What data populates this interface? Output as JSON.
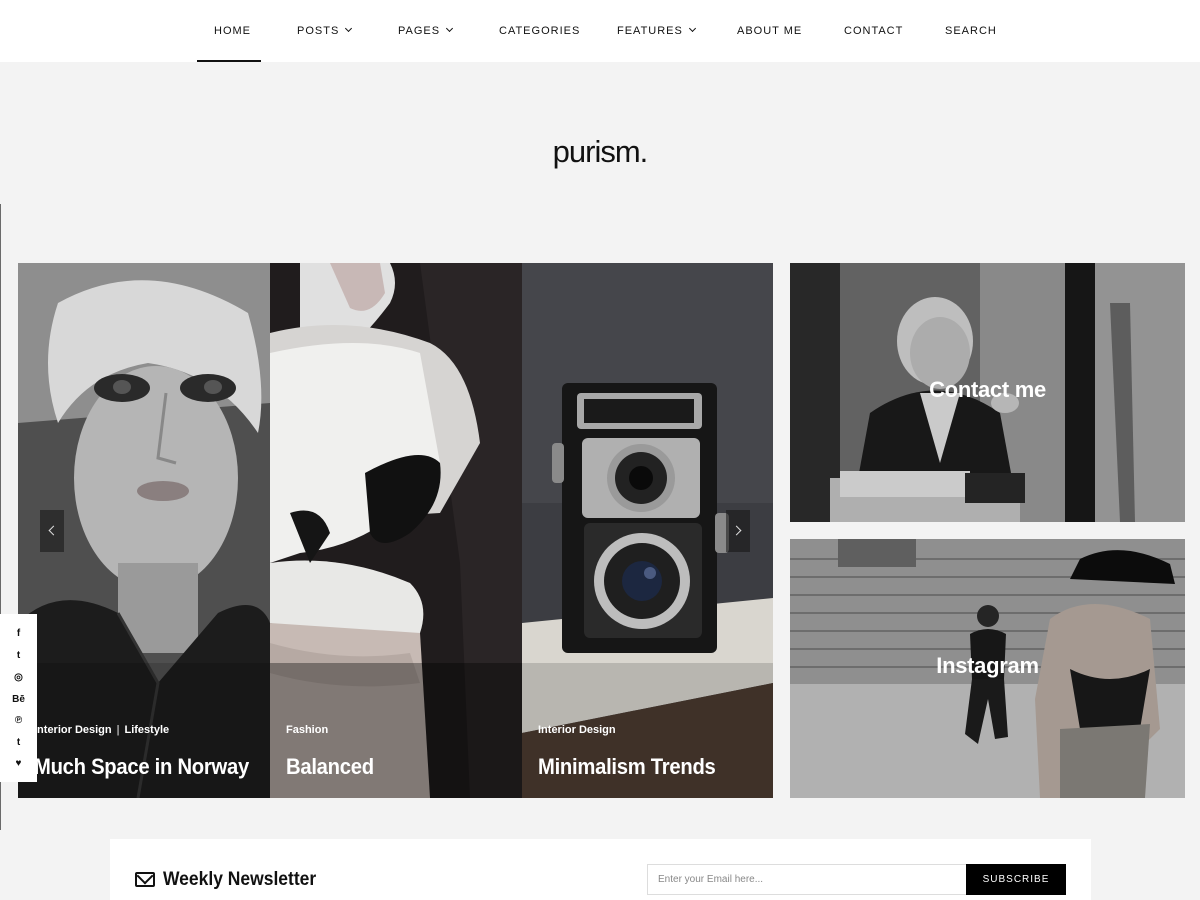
{
  "nav": {
    "items": [
      {
        "label": "HOME",
        "dropdown": false,
        "active": true
      },
      {
        "label": "POSTS",
        "dropdown": true
      },
      {
        "label": "PAGES",
        "dropdown": true
      },
      {
        "label": "CATEGORIES",
        "dropdown": false
      },
      {
        "label": "FEATURES",
        "dropdown": true
      },
      {
        "label": "ABOUT ME",
        "dropdown": false
      },
      {
        "label": "CONTACT",
        "dropdown": false
      },
      {
        "label": "SEARCH",
        "dropdown": false
      }
    ]
  },
  "site": {
    "logo": "purism."
  },
  "slider": {
    "slides": [
      {
        "categories": [
          "Interior Design",
          "Lifestyle"
        ],
        "title": "Much Space in Norway"
      },
      {
        "categories": [
          "Fashion"
        ],
        "title": "Balanced"
      },
      {
        "categories": [
          "Interior Design"
        ],
        "title": "Minimalism Trends"
      }
    ],
    "separator": "|"
  },
  "features": [
    {
      "label": "Contact me"
    },
    {
      "label": "Instagram"
    }
  ],
  "social": {
    "icons": [
      {
        "name": "facebook-icon",
        "glyph": "f"
      },
      {
        "name": "twitter-icon",
        "glyph": "t"
      },
      {
        "name": "instagram-icon",
        "glyph": "◎"
      },
      {
        "name": "behance-icon",
        "glyph": "Bē"
      },
      {
        "name": "pinterest-icon",
        "glyph": "℗"
      },
      {
        "name": "tumblr-icon",
        "glyph": "t"
      },
      {
        "name": "heart-icon",
        "glyph": "♥"
      }
    ]
  },
  "newsletter": {
    "title": "Weekly Newsletter",
    "placeholder": "Enter your Email here...",
    "button": "SUBSCRIBE"
  },
  "colors": {
    "accent": "#000000",
    "background": "#f3f3f3"
  }
}
